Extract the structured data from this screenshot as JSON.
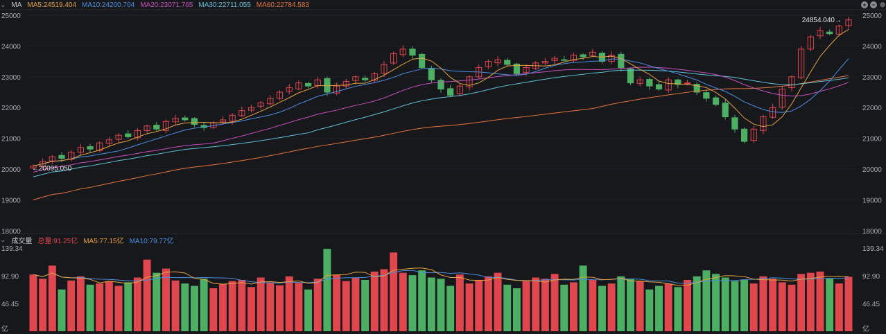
{
  "header": {
    "title": "MA",
    "ma5": "MA5:24519.404",
    "ma10": "MA10:24200.704",
    "ma20": "MA20:23071.765",
    "ma30": "MA30:22711.055",
    "ma60": "MA60:22784.583"
  },
  "volume_header": {
    "title": "成交量",
    "total": "总量:91.25亿",
    "ma5": "MA5:77.15亿",
    "ma10": "MA10:79.77亿"
  },
  "colors": {
    "up": "#e0464e",
    "down": "#4caf64",
    "ma5": "#e8a33d",
    "ma10": "#4a90e2",
    "ma20": "#c94fc0",
    "ma30": "#5fc3d8",
    "ma60": "#e8763a"
  },
  "chart_data": [
    {
      "type": "candlestick",
      "title": "MA",
      "ylim": [
        18000,
        25000
      ],
      "yticks": [
        "25000",
        "24000",
        "23000",
        "22000",
        "21000",
        "20000",
        "19000",
        "18000"
      ],
      "annotations": {
        "max": "24854.040→",
        "min": "←20095.050"
      },
      "close": [
        20100,
        20250,
        20400,
        20350,
        20550,
        20700,
        20650,
        20850,
        20950,
        21100,
        21050,
        21250,
        21400,
        21300,
        21550,
        21650,
        21600,
        21450,
        21350,
        21500,
        21600,
        21750,
        21900,
        22000,
        22150,
        22300,
        22500,
        22650,
        22800,
        22700,
        22900,
        22500,
        22700,
        22850,
        23000,
        22900,
        23100,
        23400,
        23750,
        23900,
        23700,
        23300,
        22900,
        22600,
        22400,
        22700,
        23000,
        23300,
        23500,
        23550,
        23400,
        23100,
        23300,
        23450,
        23500,
        23600,
        23550,
        23700,
        23650,
        23800,
        23500,
        23700,
        23300,
        22800,
        22900,
        22700,
        22600,
        22900,
        22750,
        22800,
        22500,
        22300,
        22100,
        21700,
        21300,
        20900,
        21300,
        21700,
        22000,
        22600,
        23000,
        23900,
        24300,
        24500,
        24400,
        24650,
        24850
      ],
      "series": [
        "MA5",
        "MA10",
        "MA20",
        "MA30",
        "MA60"
      ]
    },
    {
      "type": "bar",
      "title": "成交量",
      "ylim": [
        0,
        139.34
      ],
      "yticks": [
        "139.34",
        "92.90",
        "46.45",
        "亿"
      ],
      "values": [
        95,
        88,
        110,
        70,
        85,
        92,
        78,
        80,
        84,
        76,
        82,
        90,
        120,
        98,
        105,
        85,
        80,
        76,
        88,
        72,
        79,
        84,
        86,
        74,
        90,
        82,
        77,
        92,
        81,
        70,
        88,
        138,
        95,
        84,
        90,
        86,
        100,
        104,
        132,
        98,
        94,
        102,
        90,
        88,
        76,
        95,
        80,
        86,
        92,
        98,
        78,
        72,
        84,
        90,
        88,
        96,
        78,
        82,
        110,
        86,
        76,
        80,
        92,
        88,
        84,
        70,
        76,
        80,
        74,
        86,
        92,
        102,
        96,
        90,
        84,
        86,
        80,
        92,
        88,
        82,
        78,
        96,
        98,
        100,
        88,
        80,
        91.25
      ]
    }
  ]
}
